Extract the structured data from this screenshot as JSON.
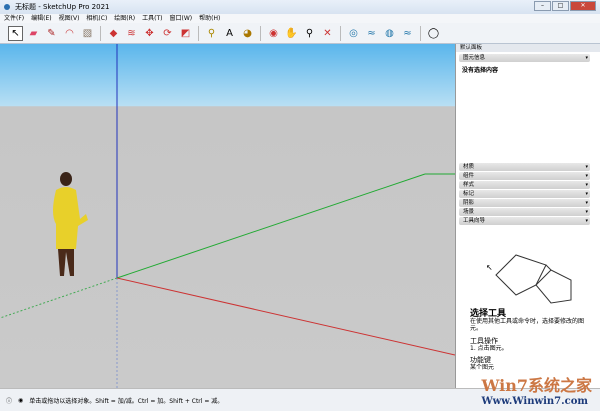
{
  "window": {
    "title": "无标题 - SketchUp Pro 2021",
    "minimize": "–",
    "maximize": "□",
    "close": "✕"
  },
  "menu": [
    "文件(F)",
    "编辑(E)",
    "视图(V)",
    "相机(C)",
    "绘图(R)",
    "工具(T)",
    "窗口(W)",
    "帮助(H)"
  ],
  "panel": {
    "title": "默认面板",
    "entity_info": "图元信息",
    "no_selection": "没有选择内容",
    "sections": [
      "材质",
      "组件",
      "样式",
      "标记",
      "阴影",
      "场景",
      "工具向导"
    ],
    "tool_title": "选择工具",
    "tool_desc": "在使用其他工具或命令时，选择要修改的图元。",
    "ops_title": "工具操作",
    "ops_item": "1. 点击图元。",
    "modifier_title": "功能键",
    "modifier_item": "某个图元"
  },
  "status": {
    "text": "单击或拖动以选择对象。Shift = 加/减。Ctrl = 加。Shift + Ctrl = 减。"
  },
  "watermark": {
    "logo": "Win7系统之家",
    "url": "Www.Winwin7.com"
  }
}
